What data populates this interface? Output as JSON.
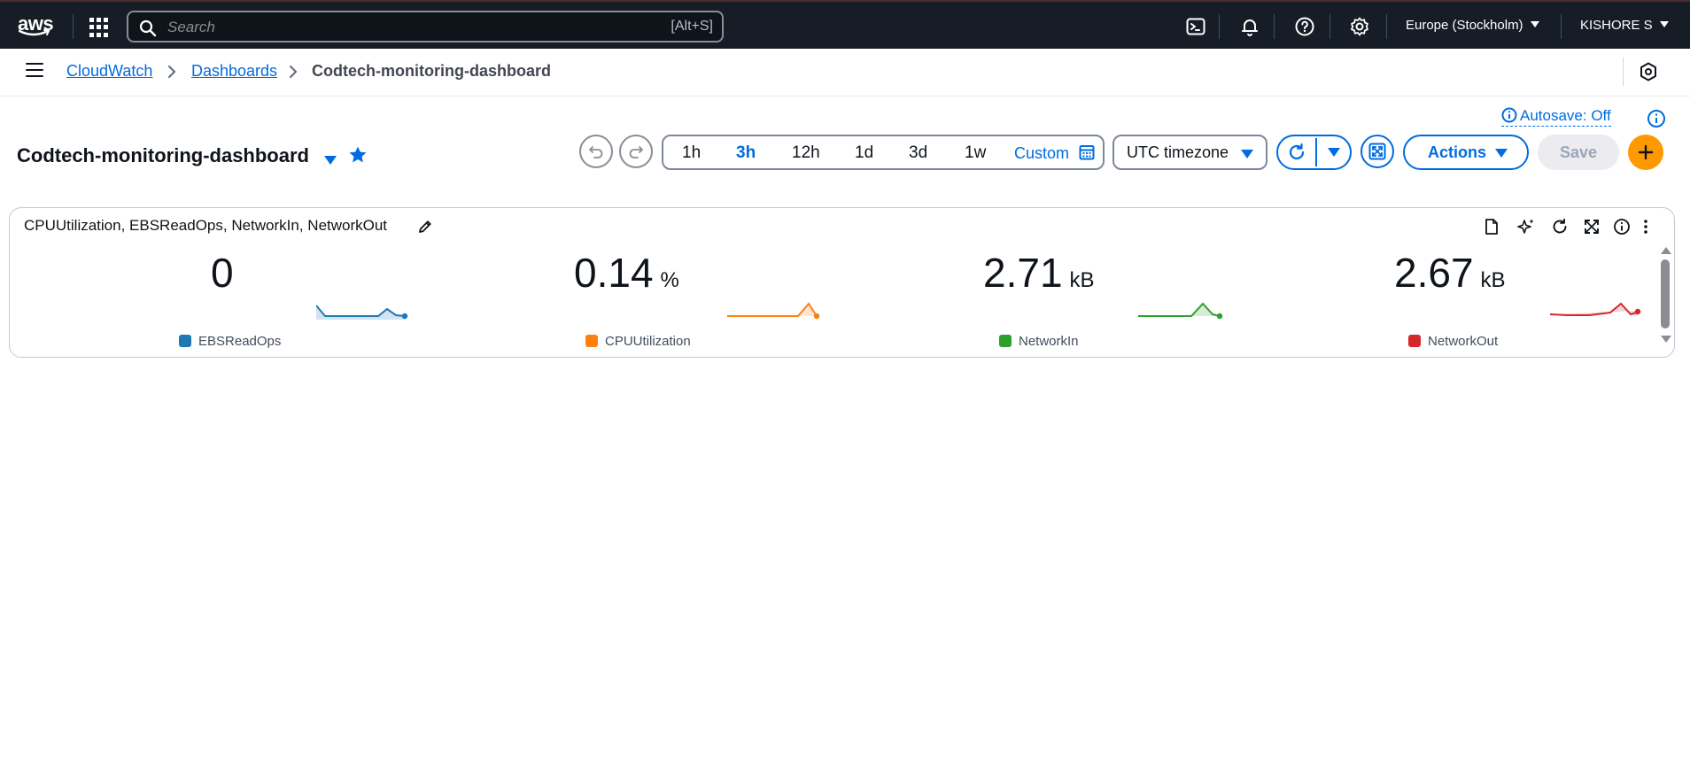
{
  "nav": {
    "logo_text": "aws",
    "search_placeholder": "Search",
    "search_shortcut": "[Alt+S]",
    "region": "Europe (Stockholm)",
    "user": "KISHORE S"
  },
  "breadcrumb": {
    "items": [
      "CloudWatch",
      "Dashboards"
    ],
    "current": "Codtech-monitoring-dashboard"
  },
  "header": {
    "autosave": "Autosave: Off",
    "title": "Codtech-monitoring-dashboard",
    "time_ranges": [
      "1h",
      "3h",
      "12h",
      "1d",
      "3d",
      "1w"
    ],
    "selected_range": "3h",
    "custom_label": "Custom",
    "timezone": "UTC timezone",
    "actions_label": "Actions",
    "save_label": "Save"
  },
  "widget": {
    "title": "CPUUtilization, EBSReadOps, NetworkIn, NetworkOut",
    "metrics": [
      {
        "value": "0",
        "unit": "",
        "name": "EBSReadOps",
        "color": "#1f77b4"
      },
      {
        "value": "0.14",
        "unit": "%",
        "name": "CPUUtilization",
        "color": "#ff7f0e"
      },
      {
        "value": "2.71",
        "unit": "kB",
        "name": "NetworkIn",
        "color": "#2ca02c"
      },
      {
        "value": "2.67",
        "unit": "kB",
        "name": "NetworkOut",
        "color": "#d62728"
      }
    ]
  },
  "colors": {
    "nav_bg": "#161d26",
    "link": "#006ce0",
    "accent_orange": "#ff9900"
  }
}
